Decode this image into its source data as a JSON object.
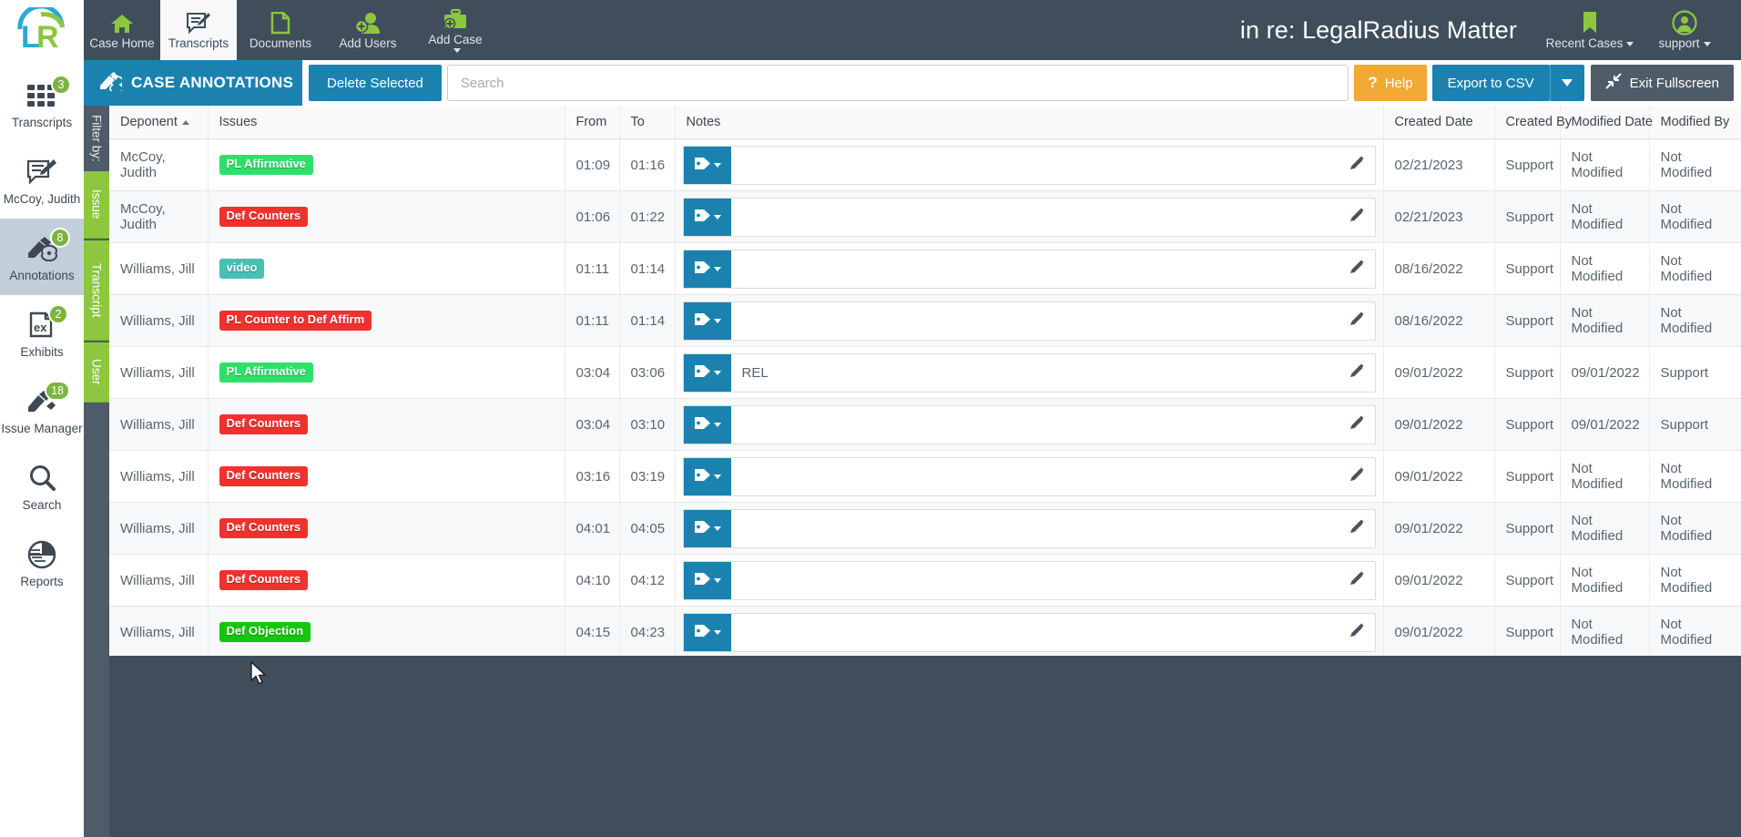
{
  "brand": {
    "logo_text": "LR"
  },
  "topnav": {
    "items": [
      {
        "label": "Case Home",
        "icon": "home-icon",
        "active": false,
        "caret": false
      },
      {
        "label": "Transcripts",
        "icon": "transcript-icon",
        "active": true,
        "caret": false
      },
      {
        "label": "Documents",
        "icon": "document-icon",
        "active": false,
        "caret": false
      },
      {
        "label": "Add Users",
        "icon": "add-user-icon",
        "active": false,
        "caret": false
      },
      {
        "label": "Add Case",
        "icon": "briefcase-icon",
        "active": false,
        "caret": true
      }
    ],
    "case_title": "in re: LegalRadius Matter",
    "recent_cases": {
      "label": "Recent Cases",
      "icon": "bookmark-icon"
    },
    "account": {
      "label": "support",
      "icon": "user-avatar-icon"
    }
  },
  "sidebar": {
    "items": [
      {
        "label": "Transcripts",
        "icon": "grid-icon",
        "badge": "3",
        "active": false
      },
      {
        "label": "McCoy, Judith",
        "icon": "transcript-icon",
        "badge": "",
        "active": false
      },
      {
        "label": "Annotations",
        "icon": "highlighter-icon",
        "badge": "8",
        "active": true
      },
      {
        "label": "Exhibits",
        "icon": "exhibit-icon",
        "badge": "2",
        "active": false
      },
      {
        "label": "Issue Manager",
        "icon": "marker-icon",
        "badge": "18",
        "active": false
      },
      {
        "label": "Search",
        "icon": "search-icon",
        "badge": "",
        "active": false
      },
      {
        "label": "Reports",
        "icon": "pie-chart-icon",
        "badge": "",
        "active": false
      }
    ]
  },
  "subbar": {
    "title": "CASE ANNOTATIONS",
    "title_icon": "highlighter-icon",
    "delete_label": "Delete Selected",
    "search_placeholder": "Search",
    "search_value": "",
    "help_label": "Help",
    "export_label": "Export to CSV",
    "exit_label": "Exit Fullscreen"
  },
  "filter_strip": {
    "heading": "Filter by:",
    "tabs": [
      "Issue",
      "Transcript",
      "User"
    ]
  },
  "table": {
    "columns": [
      {
        "key": "deponent",
        "label": "Deponent",
        "sorted": "asc"
      },
      {
        "key": "issues",
        "label": "Issues",
        "sorted": ""
      },
      {
        "key": "from",
        "label": "From",
        "sorted": ""
      },
      {
        "key": "to",
        "label": "To",
        "sorted": ""
      },
      {
        "key": "notes",
        "label": "Notes",
        "sorted": ""
      },
      {
        "key": "created_date",
        "label": "Created Date",
        "sorted": ""
      },
      {
        "key": "created_by",
        "label": "Created By",
        "sorted": ""
      },
      {
        "key": "modified_date",
        "label": "Modified Date",
        "sorted": ""
      },
      {
        "key": "modified_by",
        "label": "Modified By",
        "sorted": ""
      }
    ],
    "rows": [
      {
        "deponent": "McCoy, Judith",
        "issue": "PL Affirmative",
        "issue_color": "#2ee06a",
        "from": "01:09",
        "to": "01:16",
        "note": "",
        "created_date": "02/21/2023",
        "created_by": "Support",
        "modified_date": "Not Modified",
        "modified_by": "Not Modified",
        "modified": false
      },
      {
        "deponent": "McCoy, Judith",
        "issue": "Def Counters",
        "issue_color": "#f0322e",
        "from": "01:06",
        "to": "01:22",
        "note": "",
        "created_date": "02/21/2023",
        "created_by": "Support",
        "modified_date": "Not Modified",
        "modified_by": "Not Modified",
        "modified": false
      },
      {
        "deponent": "Williams, Jill",
        "issue": "video",
        "issue_color": "#48c0b4",
        "from": "01:11",
        "to": "01:14",
        "note": "",
        "created_date": "08/16/2022",
        "created_by": "Support",
        "modified_date": "Not Modified",
        "modified_by": "Not Modified",
        "modified": false
      },
      {
        "deponent": "Williams, Jill",
        "issue": "PL Counter to Def Affirm",
        "issue_color": "#f0322e",
        "from": "01:11",
        "to": "01:14",
        "note": "",
        "created_date": "08/16/2022",
        "created_by": "Support",
        "modified_date": "Not Modified",
        "modified_by": "Not Modified",
        "modified": false
      },
      {
        "deponent": "Williams, Jill",
        "issue": "PL Affirmative",
        "issue_color": "#2ee06a",
        "from": "03:04",
        "to": "03:06",
        "note": "REL",
        "created_date": "09/01/2022",
        "created_by": "Support",
        "modified_date": "09/01/2022",
        "modified_by": "Support",
        "modified": true
      },
      {
        "deponent": "Williams, Jill",
        "issue": "Def Counters",
        "issue_color": "#f0322e",
        "from": "03:04",
        "to": "03:10",
        "note": "",
        "created_date": "09/01/2022",
        "created_by": "Support",
        "modified_date": "09/01/2022",
        "modified_by": "Support",
        "modified": true
      },
      {
        "deponent": "Williams, Jill",
        "issue": "Def Counters",
        "issue_color": "#f0322e",
        "from": "03:16",
        "to": "03:19",
        "note": "",
        "created_date": "09/01/2022",
        "created_by": "Support",
        "modified_date": "Not Modified",
        "modified_by": "Not Modified",
        "modified": false
      },
      {
        "deponent": "Williams, Jill",
        "issue": "Def Counters",
        "issue_color": "#f0322e",
        "from": "04:01",
        "to": "04:05",
        "note": "",
        "created_date": "09/01/2022",
        "created_by": "Support",
        "modified_date": "Not Modified",
        "modified_by": "Not Modified",
        "modified": false
      },
      {
        "deponent": "Williams, Jill",
        "issue": "Def Counters",
        "issue_color": "#f0322e",
        "from": "04:10",
        "to": "04:12",
        "note": "",
        "created_date": "09/01/2022",
        "created_by": "Support",
        "modified_date": "Not Modified",
        "modified_by": "Not Modified",
        "modified": false
      },
      {
        "deponent": "Williams, Jill",
        "issue": "Def Objection",
        "issue_color": "#16c60c",
        "from": "04:15",
        "to": "04:23",
        "note": "",
        "created_date": "09/01/2022",
        "created_by": "Support",
        "modified_date": "Not Modified",
        "modified_by": "Not Modified",
        "modified": false
      }
    ]
  },
  "colors": {
    "header_bg": "#404e5c",
    "accent_blue": "#1b82b0",
    "accent_green": "#8dc63f",
    "help_orange": "#f0a934",
    "exit_gray": "#4e5b68",
    "canvas": "#404e5c"
  }
}
